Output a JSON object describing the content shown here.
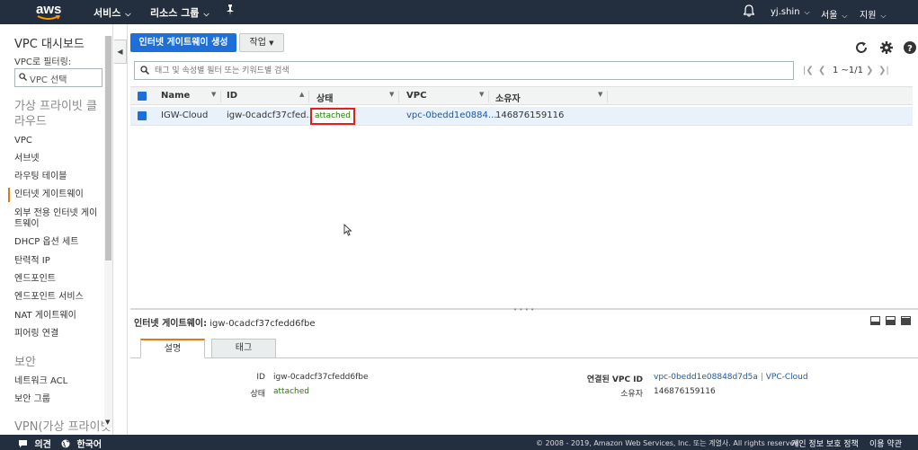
{
  "topnav": {
    "logo": "aws",
    "services": "서비스",
    "resource_groups": "리소스 그룹",
    "pin_icon": "pin-icon",
    "bell_icon": "bell-icon",
    "user": "yj.shin",
    "region": "서울",
    "support": "지원"
  },
  "sidebar": {
    "dashboard_title": "VPC 대시보드",
    "filter_label": "VPC로 필터링:",
    "vpc_select_placeholder": "VPC 선택",
    "section_virtual": "가상 프라이빗 클라우드",
    "items": [
      {
        "label": "VPC"
      },
      {
        "label": "서브넷"
      },
      {
        "label": "라우팅 테이블"
      },
      {
        "label": "인터넷 게이트웨이"
      },
      {
        "label": "외부 전용 인터넷 게이트웨이"
      },
      {
        "label": "DHCP 옵션 세트"
      },
      {
        "label": "탄력적 IP"
      },
      {
        "label": "엔드포인트"
      },
      {
        "label": "엔드포인트 서비스"
      },
      {
        "label": "NAT 게이트웨이"
      },
      {
        "label": "피어링 연결"
      }
    ],
    "section_security": "보안",
    "security_items": [
      {
        "label": "네트워크 ACL"
      },
      {
        "label": "보안 그룹"
      }
    ],
    "section_vpn": "VPN(가상 프라이빗"
  },
  "toolbar": {
    "create_button": "인터넷 게이트웨이 생성",
    "actions_button": "작업",
    "refresh_icon": "refresh-icon",
    "settings_icon": "gear-icon",
    "help_icon": "help-icon"
  },
  "search": {
    "placeholder": "태그 및 속성별 필터 또는 키워드별 검색"
  },
  "pager": {
    "text": "1 ~1/1"
  },
  "table": {
    "columns": [
      "Name",
      "ID",
      "상태",
      "VPC",
      "소유자"
    ],
    "rows": [
      {
        "name": "IGW-Cloud",
        "id": "igw-0cadcf37cfed...",
        "state": "attached",
        "vpc": "vpc-0bedd1e0884...",
        "owner": "146876159116"
      }
    ]
  },
  "detail": {
    "title_label": "인터넷 게이트웨이:",
    "title_value": "igw-0cadcf37cfedd6fbe",
    "tabs": [
      "설명",
      "태그"
    ],
    "fields": {
      "id_label": "ID",
      "id_value": "igw-0cadcf37cfedd6fbe",
      "state_label": "상태",
      "state_value": "attached",
      "vpc_label": "연결된 VPC ID",
      "vpc_id": "vpc-0bedd1e08848d7d5a",
      "vpc_sep": "|",
      "vpc_name": "VPC-Cloud",
      "owner_label": "소유자",
      "owner_value": "146876159116"
    }
  },
  "footer": {
    "feedback": "의견",
    "language": "한국어",
    "copyright": "© 2008 - 2019, Amazon Web Services, Inc. 또는 계열사. All rights reserved.",
    "privacy": "개인 정보 보호 정책",
    "terms": "이용 약관"
  },
  "colors": {
    "nav_bg": "#232f3e",
    "primary_button": "#1f6fd8",
    "attached_green": "#1d8102",
    "link_blue": "#1e5799",
    "highlight_red": "#e01f1f",
    "active_orange": "#e47911"
  }
}
